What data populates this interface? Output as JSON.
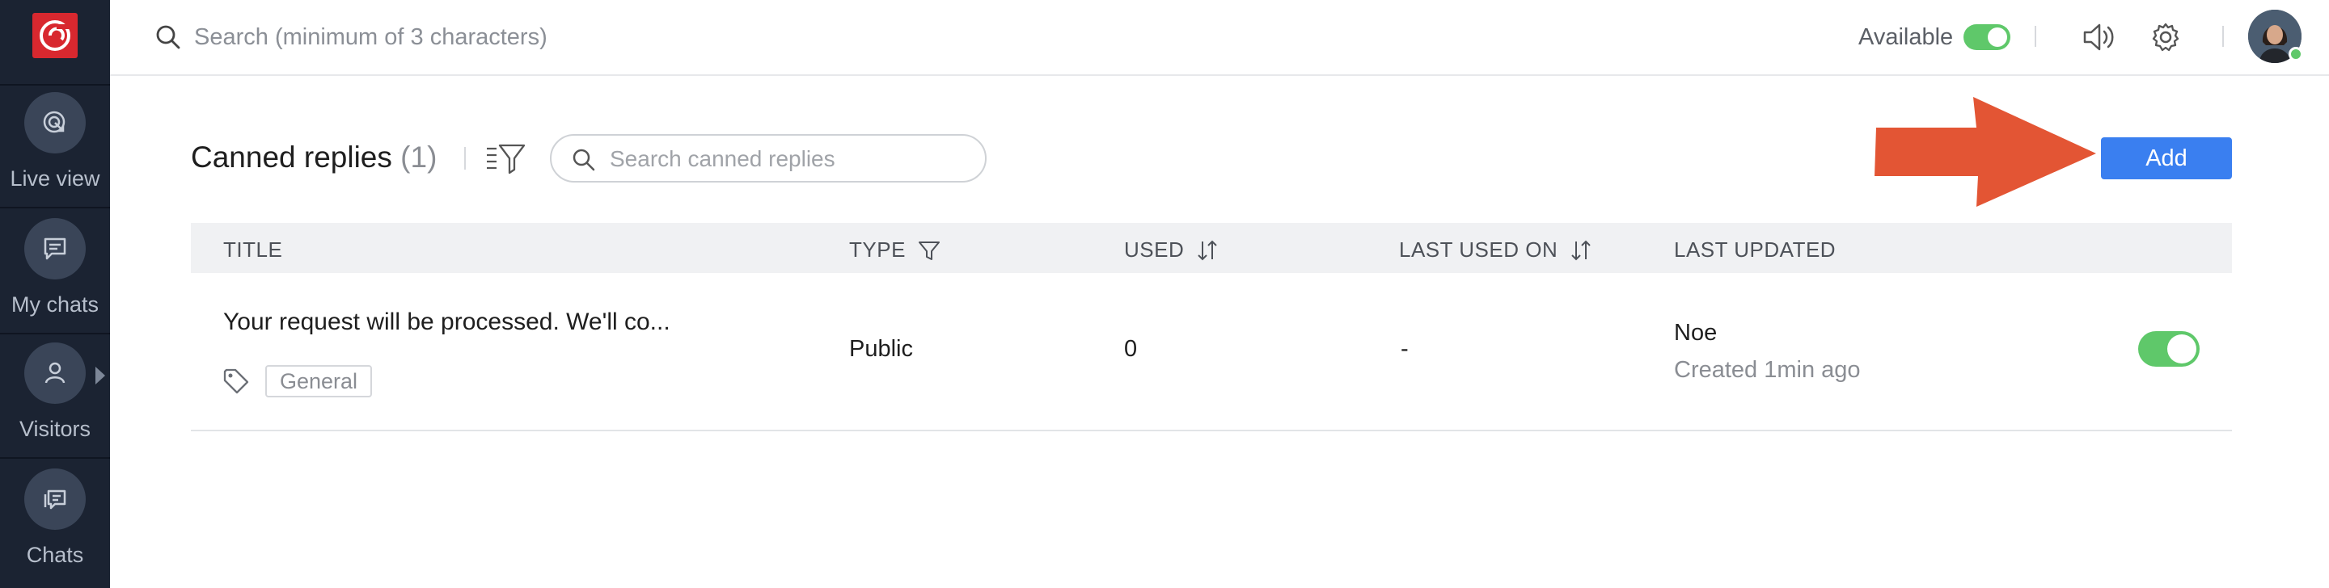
{
  "sidebar": {
    "items": [
      {
        "label": "Live view",
        "icon": "live-view-icon"
      },
      {
        "label": "My chats",
        "icon": "chat-bubble-icon"
      },
      {
        "label": "Visitors",
        "icon": "visitor-icon"
      },
      {
        "label": "Chats",
        "icon": "chats-icon"
      }
    ]
  },
  "topbar": {
    "search_placeholder": "Search (minimum of 3 characters)",
    "availability_label": "Available",
    "availability_on": true
  },
  "page": {
    "title": "Canned replies",
    "count": "(1)",
    "search_placeholder": "Search canned replies",
    "add_label": "Add"
  },
  "table": {
    "columns": [
      "TITLE",
      "TYPE",
      "USED",
      "LAST USED ON",
      "LAST UPDATED"
    ],
    "rows": [
      {
        "title": "Your request will be processed. We'll co...",
        "tag": "General",
        "type": "Public",
        "used": "0",
        "last_used_on": "-",
        "updated_by": "Noe",
        "updated_when": "Created 1min ago",
        "enabled": true
      }
    ]
  },
  "colors": {
    "sidebar_bg": "#1b2332",
    "brand_red": "#d8282f",
    "accent_blue": "#3a7ff0",
    "toggle_green": "#5fc86a",
    "annotation_arrow": "#e35534"
  }
}
